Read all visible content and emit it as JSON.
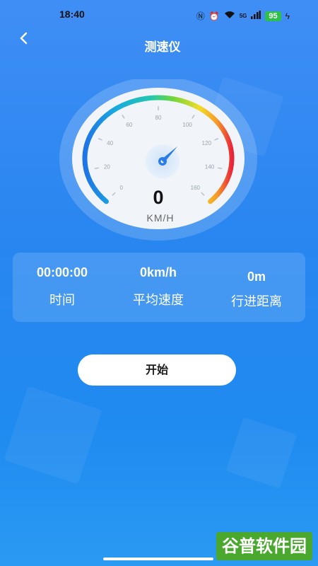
{
  "status_bar": {
    "time": "18:40",
    "network": "5G",
    "battery": "95"
  },
  "nav": {
    "back_icon": "chevron-left",
    "title": "测速仪"
  },
  "gauge": {
    "value": "0",
    "unit": "KM/H",
    "ticks": [
      "0",
      "20",
      "40",
      "60",
      "80",
      "100",
      "120",
      "140",
      "160"
    ],
    "min": 0,
    "max": 160,
    "current": 0,
    "colors": {
      "low": "#1f74e6",
      "mid": "#2fd06a",
      "midhigh": "#f5e12a",
      "high": "#e8263a"
    }
  },
  "stats": [
    {
      "value": "00:00:00",
      "label": "时间"
    },
    {
      "value": "0km/h",
      "label": "平均速度"
    },
    {
      "value": "0m",
      "label": "行进距离"
    }
  ],
  "start_button": {
    "label": "开始"
  },
  "watermark": {
    "text": "谷普软件园"
  }
}
